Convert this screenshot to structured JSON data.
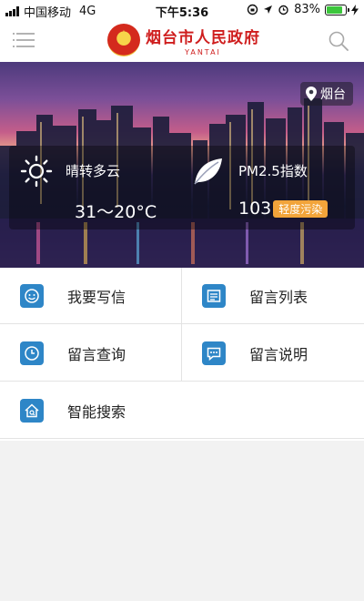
{
  "status_bar": {
    "carrier": "中国移动",
    "network": "4G",
    "time": "下午5:36",
    "battery": "83%",
    "battery_level": 0.83
  },
  "header": {
    "title": "烟台市人民政府",
    "subtitle": "YANTAI"
  },
  "banner": {
    "location": "烟台",
    "weather": {
      "condition": "晴转多云",
      "temperature": "31～20°C"
    },
    "air": {
      "label": "PM2.5指数",
      "value": "103",
      "level": "轻度污染"
    }
  },
  "menu": [
    {
      "label": "我要写信",
      "icon": "write-letter-icon"
    },
    {
      "label": "留言列表",
      "icon": "message-list-icon"
    },
    {
      "label": "留言查询",
      "icon": "clock-icon"
    },
    {
      "label": "留言说明",
      "icon": "chat-icon"
    },
    {
      "label": "智能搜索",
      "icon": "home-search-icon"
    }
  ],
  "colors": {
    "brand_red": "#cf1e1e",
    "icon_blue": "#2e86c7",
    "aqi_orange": "#f2a43a",
    "battery_green": "#3cc63c"
  }
}
